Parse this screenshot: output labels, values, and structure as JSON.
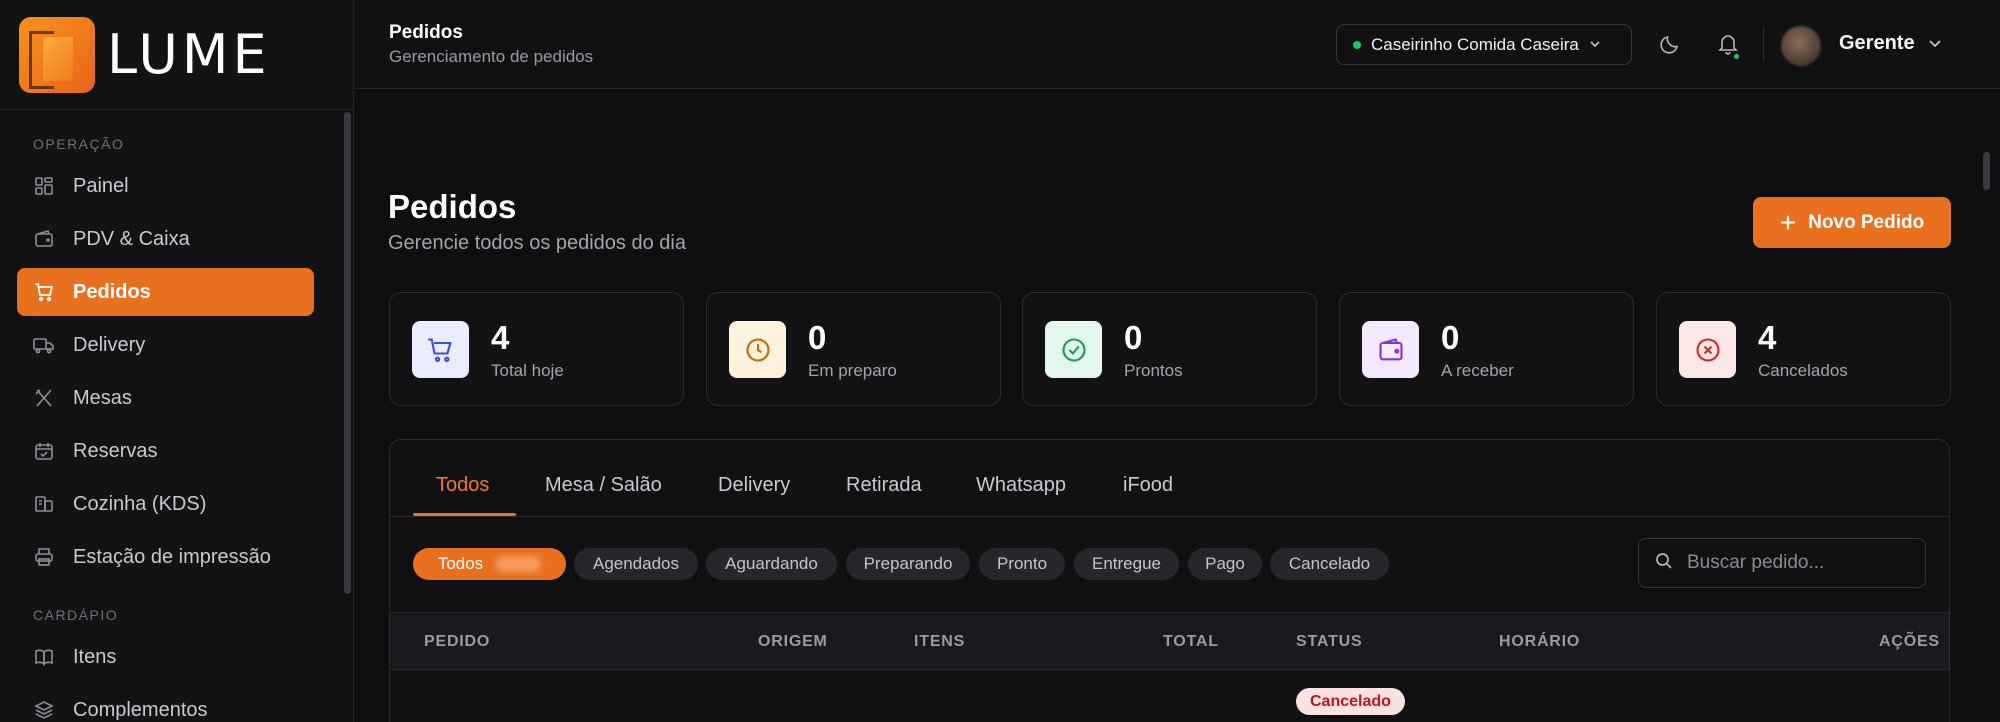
{
  "brand": {
    "name": "LUME"
  },
  "sidebar": {
    "sections": [
      {
        "title": "OPERAÇÃO",
        "items": [
          {
            "label": "Painel",
            "icon": "dashboard-icon"
          },
          {
            "label": "PDV & Caixa",
            "icon": "wallet-icon"
          },
          {
            "label": "Pedidos",
            "icon": "cart-icon",
            "active": true
          },
          {
            "label": "Delivery",
            "icon": "truck-icon"
          },
          {
            "label": "Mesas",
            "icon": "utensils-icon"
          },
          {
            "label": "Reservas",
            "icon": "calendar-check-icon"
          },
          {
            "label": "Cozinha (KDS)",
            "icon": "kds-icon"
          },
          {
            "label": "Estação de impressão",
            "icon": "printer-icon"
          }
        ]
      },
      {
        "title": "CARDÁPIO",
        "items": [
          {
            "label": "Itens",
            "icon": "book-icon"
          },
          {
            "label": "Complementos",
            "icon": "layers-icon"
          }
        ]
      }
    ]
  },
  "header": {
    "title": "Pedidos",
    "subtitle": "Gerenciamento de pedidos",
    "store": "Caseirinho Comida Caseira",
    "user": "Gerente"
  },
  "page": {
    "title": "Pedidos",
    "subtitle": "Gerencie todos os pedidos do dia",
    "new_button": "Novo Pedido"
  },
  "stats": [
    {
      "value": "4",
      "label": "Total hoje",
      "icon": "cart-icon",
      "color": "#3b4fd9",
      "bg": "#e9edfd"
    },
    {
      "value": "0",
      "label": "Em preparo",
      "icon": "clock-icon",
      "color": "#c26a0a",
      "bg": "#fdf2dc"
    },
    {
      "value": "0",
      "label": "Prontos",
      "icon": "check-circle-icon",
      "color": "#179a52",
      "bg": "#e3f8ec"
    },
    {
      "value": "0",
      "label": "A receber",
      "icon": "wallet-icon",
      "color": "#8b2fd6",
      "bg": "#f4e9fd"
    },
    {
      "value": "4",
      "label": "Cancelados",
      "icon": "x-circle-icon",
      "color": "#d62828",
      "bg": "#fde8e8"
    }
  ],
  "tabs": [
    "Todos",
    "Mesa / Salão",
    "Delivery",
    "Retirada",
    "Whatsapp",
    "iFood"
  ],
  "filters": [
    "Todos",
    "Agendados",
    "Aguardando",
    "Preparando",
    "Pronto",
    "Entregue",
    "Pago",
    "Cancelado"
  ],
  "search": {
    "placeholder": "Buscar pedido..."
  },
  "table": {
    "columns": [
      "PEDIDO",
      "ORIGEM",
      "ITENS",
      "TOTAL",
      "STATUS",
      "HORÁRIO",
      "AÇÕES"
    ],
    "rows": [
      {
        "status": "Cancelado"
      }
    ]
  }
}
